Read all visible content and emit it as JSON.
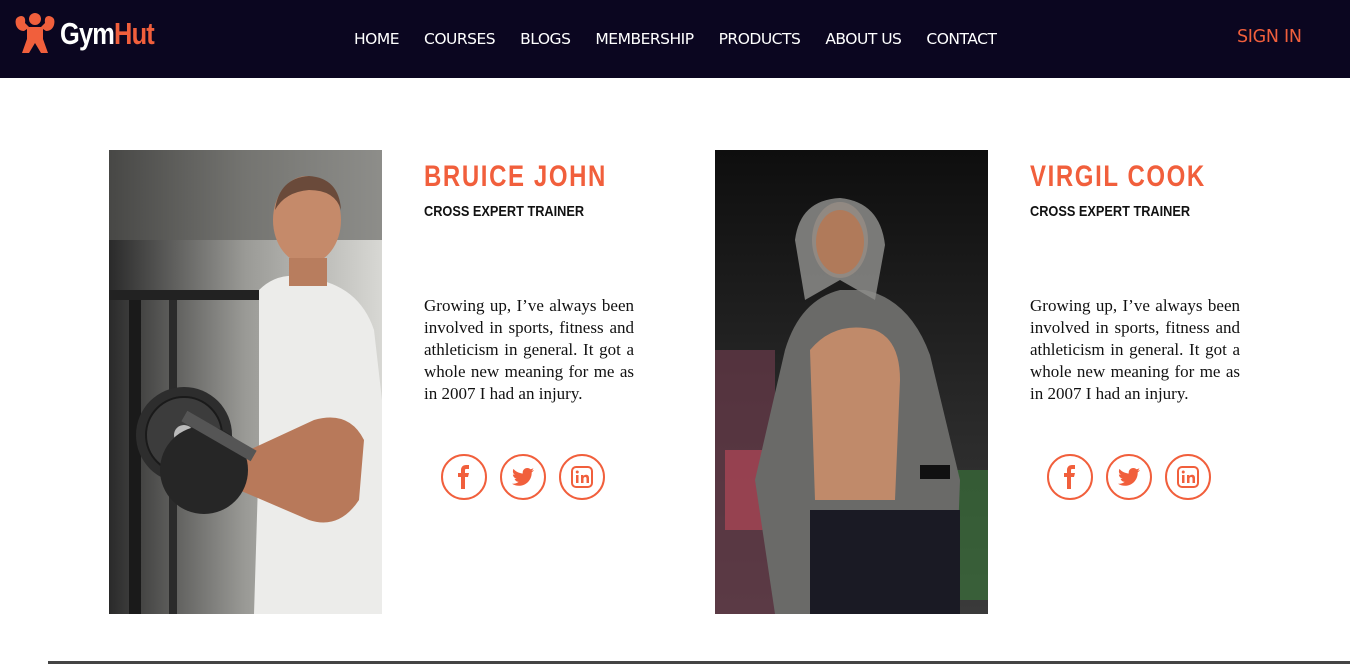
{
  "brand": {
    "part1": "Gym",
    "part2": "Hut"
  },
  "nav": {
    "items": [
      "HOME",
      "COURSES",
      "BLOGS",
      "MEMBERSHIP",
      "PRODUCTS",
      "ABOUT US",
      "CONTACT"
    ],
    "sign_in": "SIGN IN"
  },
  "trainers": [
    {
      "name": "BRUICE JOHN",
      "role": "CROSS EXPERT TRAINER",
      "bio": "Growing up, I’ve always been involved in sports, fitness and athleticism in general. It got a whole new meaning for me as in 2007 I had an injury.",
      "socials": [
        "facebook-icon",
        "twitter-icon",
        "linkedin-icon"
      ]
    },
    {
      "name": "VIRGIL COOK",
      "role": "CROSS EXPERT TRAINER",
      "bio": "Growing up, I’ve always been involved in sports, fitness and athleticism in general. It got a whole new meaning for me as in 2007 I had an injury.",
      "socials": [
        "facebook-icon",
        "twitter-icon",
        "linkedin-icon"
      ]
    }
  ],
  "colors": {
    "accent": "#f15f3c",
    "nav_bg": "#0b0620",
    "text": "#111111"
  }
}
